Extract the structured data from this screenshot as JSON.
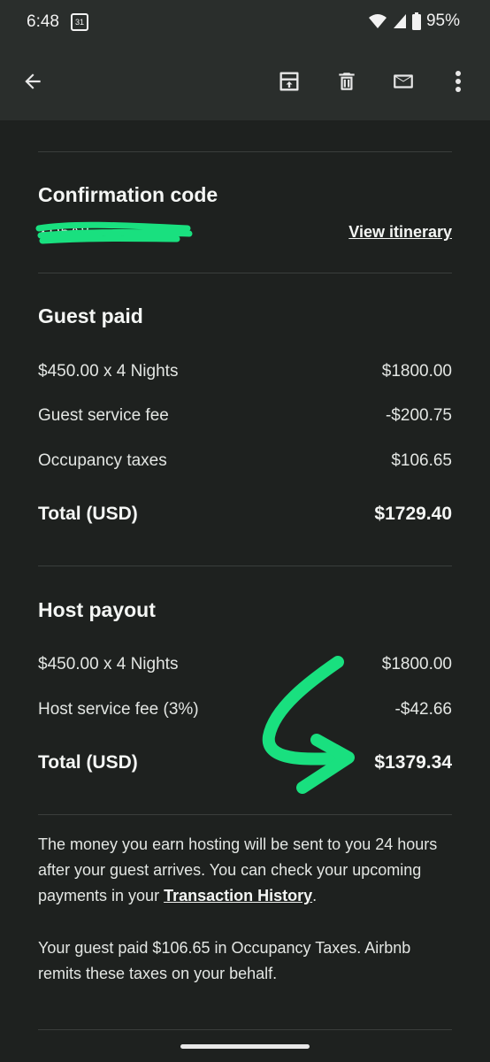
{
  "status": {
    "time": "6:48",
    "calendar_day": "31",
    "battery": "95%"
  },
  "appbar": {
    "icons": [
      "back-arrow-icon",
      "archive-icon",
      "delete-icon",
      "mark-unread-icon",
      "more-vert-icon"
    ]
  },
  "confirmation": {
    "heading": "Confirmation code",
    "code_visible": "XD5A8",
    "view_itinerary": "View itinerary"
  },
  "guest_paid": {
    "heading": "Guest paid",
    "rows": [
      {
        "label": "$450.00 x 4 Nights",
        "value": "$1800.00"
      },
      {
        "label": "Guest service fee",
        "value": "-$200.75"
      },
      {
        "label": "Occupancy taxes",
        "value": "$106.65"
      }
    ],
    "total_label": "Total (USD)",
    "total_value": "$1729.40"
  },
  "host_payout": {
    "heading": "Host payout",
    "rows": [
      {
        "label": "$450.00 x 4 Nights",
        "value": "$1800.00"
      },
      {
        "label": "Host service fee (3%)",
        "value": "-$42.66"
      }
    ],
    "total_label": "Total (USD)",
    "total_value": "$1379.34"
  },
  "notes": {
    "p1_before": "The money you earn hosting will be sent to you 24 hours after your guest arrives. You can check your upcoming payments in your ",
    "p1_link": "Transaction History",
    "p1_after": ".",
    "p2": "Your guest paid $106.65 in Occupancy Taxes. Airbnb remits these taxes on your behalf."
  },
  "colors": {
    "background": "#1e211f",
    "appbar": "#2a2e2c",
    "annotation": "#19e07f"
  }
}
